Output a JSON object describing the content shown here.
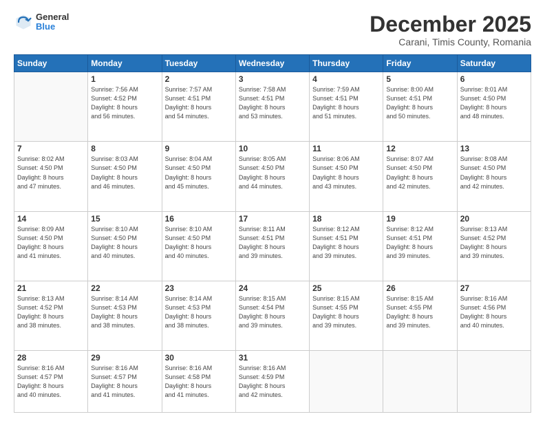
{
  "header": {
    "logo_general": "General",
    "logo_blue": "Blue",
    "month_title": "December 2025",
    "subtitle": "Carani, Timis County, Romania"
  },
  "weekdays": [
    "Sunday",
    "Monday",
    "Tuesday",
    "Wednesday",
    "Thursday",
    "Friday",
    "Saturday"
  ],
  "weeks": [
    [
      {
        "day": "",
        "info": ""
      },
      {
        "day": "1",
        "info": "Sunrise: 7:56 AM\nSunset: 4:52 PM\nDaylight: 8 hours\nand 56 minutes."
      },
      {
        "day": "2",
        "info": "Sunrise: 7:57 AM\nSunset: 4:51 PM\nDaylight: 8 hours\nand 54 minutes."
      },
      {
        "day": "3",
        "info": "Sunrise: 7:58 AM\nSunset: 4:51 PM\nDaylight: 8 hours\nand 53 minutes."
      },
      {
        "day": "4",
        "info": "Sunrise: 7:59 AM\nSunset: 4:51 PM\nDaylight: 8 hours\nand 51 minutes."
      },
      {
        "day": "5",
        "info": "Sunrise: 8:00 AM\nSunset: 4:51 PM\nDaylight: 8 hours\nand 50 minutes."
      },
      {
        "day": "6",
        "info": "Sunrise: 8:01 AM\nSunset: 4:50 PM\nDaylight: 8 hours\nand 48 minutes."
      }
    ],
    [
      {
        "day": "7",
        "info": "Sunrise: 8:02 AM\nSunset: 4:50 PM\nDaylight: 8 hours\nand 47 minutes."
      },
      {
        "day": "8",
        "info": "Sunrise: 8:03 AM\nSunset: 4:50 PM\nDaylight: 8 hours\nand 46 minutes."
      },
      {
        "day": "9",
        "info": "Sunrise: 8:04 AM\nSunset: 4:50 PM\nDaylight: 8 hours\nand 45 minutes."
      },
      {
        "day": "10",
        "info": "Sunrise: 8:05 AM\nSunset: 4:50 PM\nDaylight: 8 hours\nand 44 minutes."
      },
      {
        "day": "11",
        "info": "Sunrise: 8:06 AM\nSunset: 4:50 PM\nDaylight: 8 hours\nand 43 minutes."
      },
      {
        "day": "12",
        "info": "Sunrise: 8:07 AM\nSunset: 4:50 PM\nDaylight: 8 hours\nand 42 minutes."
      },
      {
        "day": "13",
        "info": "Sunrise: 8:08 AM\nSunset: 4:50 PM\nDaylight: 8 hours\nand 42 minutes."
      }
    ],
    [
      {
        "day": "14",
        "info": "Sunrise: 8:09 AM\nSunset: 4:50 PM\nDaylight: 8 hours\nand 41 minutes."
      },
      {
        "day": "15",
        "info": "Sunrise: 8:10 AM\nSunset: 4:50 PM\nDaylight: 8 hours\nand 40 minutes."
      },
      {
        "day": "16",
        "info": "Sunrise: 8:10 AM\nSunset: 4:50 PM\nDaylight: 8 hours\nand 40 minutes."
      },
      {
        "day": "17",
        "info": "Sunrise: 8:11 AM\nSunset: 4:51 PM\nDaylight: 8 hours\nand 39 minutes."
      },
      {
        "day": "18",
        "info": "Sunrise: 8:12 AM\nSunset: 4:51 PM\nDaylight: 8 hours\nand 39 minutes."
      },
      {
        "day": "19",
        "info": "Sunrise: 8:12 AM\nSunset: 4:51 PM\nDaylight: 8 hours\nand 39 minutes."
      },
      {
        "day": "20",
        "info": "Sunrise: 8:13 AM\nSunset: 4:52 PM\nDaylight: 8 hours\nand 39 minutes."
      }
    ],
    [
      {
        "day": "21",
        "info": "Sunrise: 8:13 AM\nSunset: 4:52 PM\nDaylight: 8 hours\nand 38 minutes."
      },
      {
        "day": "22",
        "info": "Sunrise: 8:14 AM\nSunset: 4:53 PM\nDaylight: 8 hours\nand 38 minutes."
      },
      {
        "day": "23",
        "info": "Sunrise: 8:14 AM\nSunset: 4:53 PM\nDaylight: 8 hours\nand 38 minutes."
      },
      {
        "day": "24",
        "info": "Sunrise: 8:15 AM\nSunset: 4:54 PM\nDaylight: 8 hours\nand 39 minutes."
      },
      {
        "day": "25",
        "info": "Sunrise: 8:15 AM\nSunset: 4:55 PM\nDaylight: 8 hours\nand 39 minutes."
      },
      {
        "day": "26",
        "info": "Sunrise: 8:15 AM\nSunset: 4:55 PM\nDaylight: 8 hours\nand 39 minutes."
      },
      {
        "day": "27",
        "info": "Sunrise: 8:16 AM\nSunset: 4:56 PM\nDaylight: 8 hours\nand 40 minutes."
      }
    ],
    [
      {
        "day": "28",
        "info": "Sunrise: 8:16 AM\nSunset: 4:57 PM\nDaylight: 8 hours\nand 40 minutes."
      },
      {
        "day": "29",
        "info": "Sunrise: 8:16 AM\nSunset: 4:57 PM\nDaylight: 8 hours\nand 41 minutes."
      },
      {
        "day": "30",
        "info": "Sunrise: 8:16 AM\nSunset: 4:58 PM\nDaylight: 8 hours\nand 41 minutes."
      },
      {
        "day": "31",
        "info": "Sunrise: 8:16 AM\nSunset: 4:59 PM\nDaylight: 8 hours\nand 42 minutes."
      },
      {
        "day": "",
        "info": ""
      },
      {
        "day": "",
        "info": ""
      },
      {
        "day": "",
        "info": ""
      }
    ]
  ]
}
